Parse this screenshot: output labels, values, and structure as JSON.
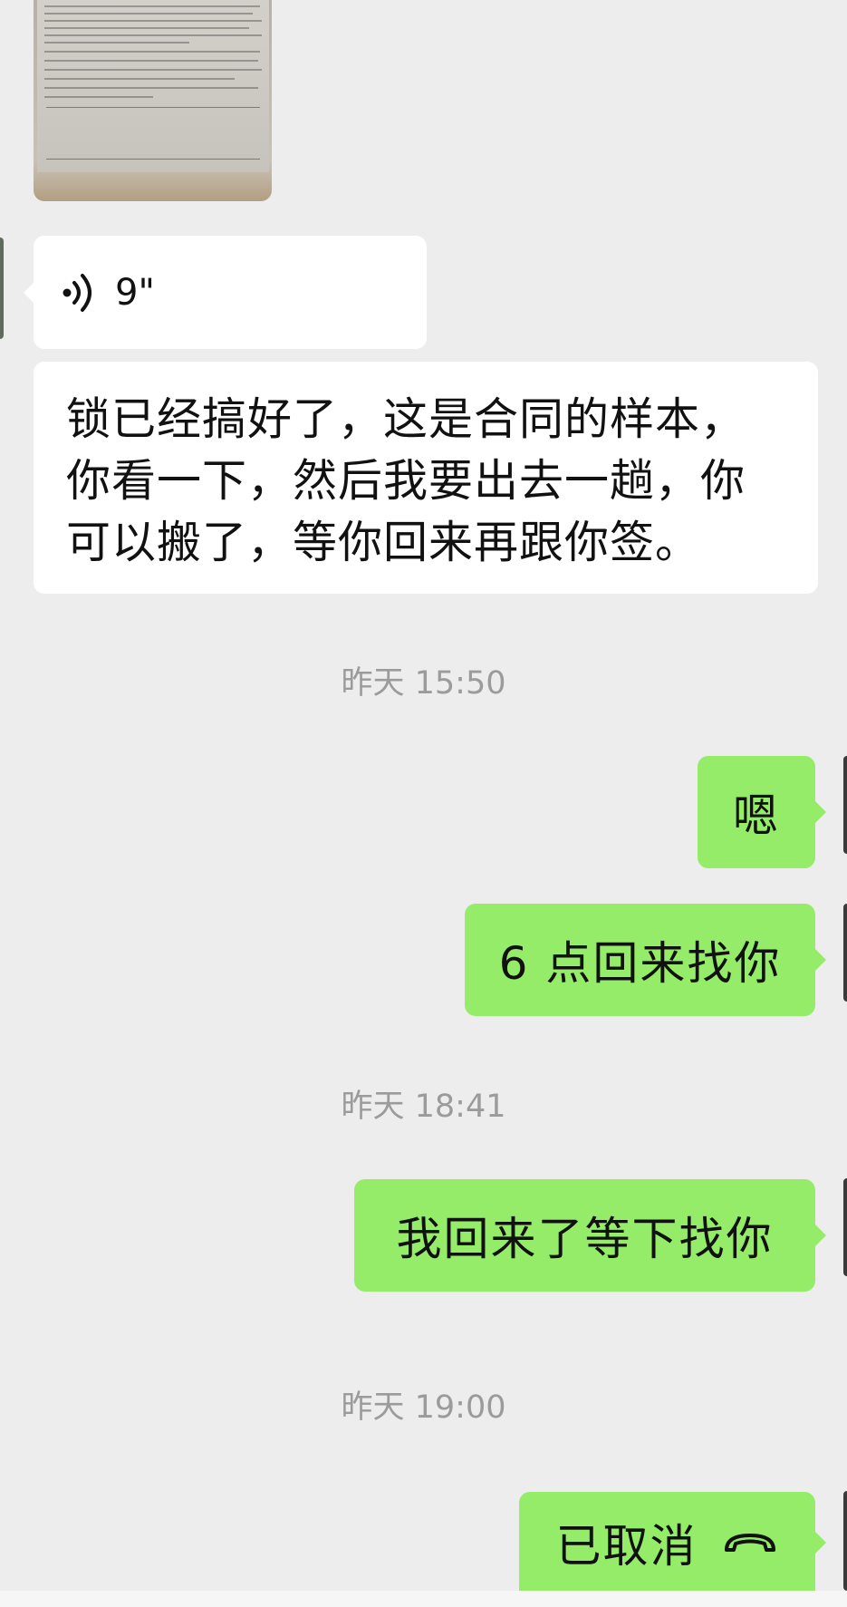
{
  "messages": {
    "voice": {
      "duration": "9\"",
      "icon": "voice-wave-icon"
    },
    "text_from_contact": {
      "lines": [
        "锁已经搞好了，这是合同的样本，",
        "你看一下，然后我要出去一趟，你",
        "可以搬了，等你回来再跟你签。"
      ]
    },
    "time_1": "昨天 15:50",
    "reply_1": "嗯",
    "reply_2": "6 点回来找你",
    "time_2": "昨天 18:41",
    "reply_3": "我回来了等下找你",
    "time_3": "昨天 19:00",
    "call_status": {
      "label": "已取消",
      "icon": "hangup-phone-icon"
    }
  },
  "colors": {
    "background": "#ededed",
    "incoming_bubble": "#ffffff",
    "outgoing_bubble": "#95ec69",
    "timestamp": "#9b9b9b"
  }
}
